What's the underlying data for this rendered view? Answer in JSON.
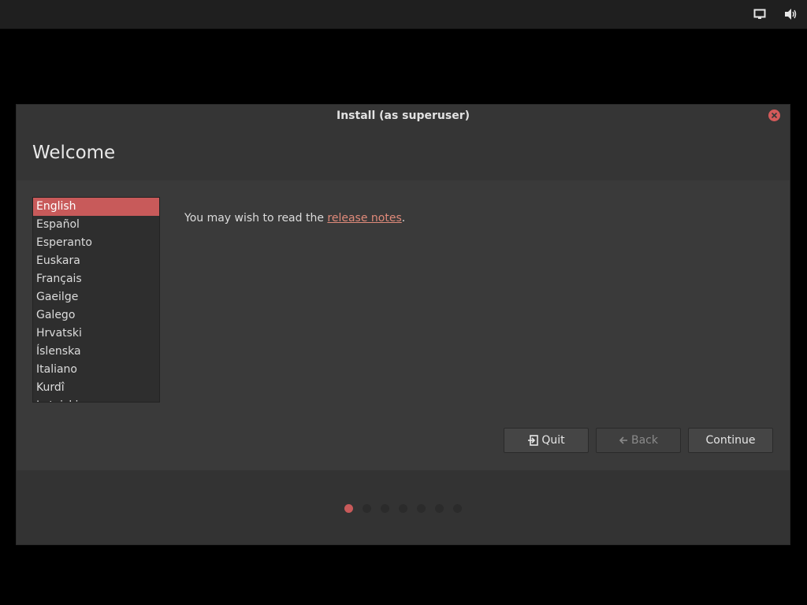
{
  "top_panel": {
    "icons": [
      "display-icon",
      "volume-icon"
    ]
  },
  "window": {
    "title": "Install (as superuser)",
    "close_icon": "close-icon"
  },
  "page": {
    "title": "Welcome"
  },
  "languages": {
    "selected_index": 0,
    "items": [
      "English",
      "Español",
      "Esperanto",
      "Euskara",
      "Français",
      "Gaeilge",
      "Galego",
      "Hrvatski",
      "Íslenska",
      "Italiano",
      "Kurdî",
      "Latviski"
    ]
  },
  "release": {
    "prefix": "You may wish to read the ",
    "link_label": "release notes",
    "suffix": "."
  },
  "buttons": {
    "quit_label": "Quit",
    "back_label": "Back",
    "continue_label": "Continue"
  },
  "progress": {
    "total_steps": 7,
    "current_step": 1
  },
  "colors": {
    "accent": "#c85a5a",
    "link": "#e08a7a",
    "window_bg": "#353535",
    "content_bg": "#3a3a3a"
  }
}
